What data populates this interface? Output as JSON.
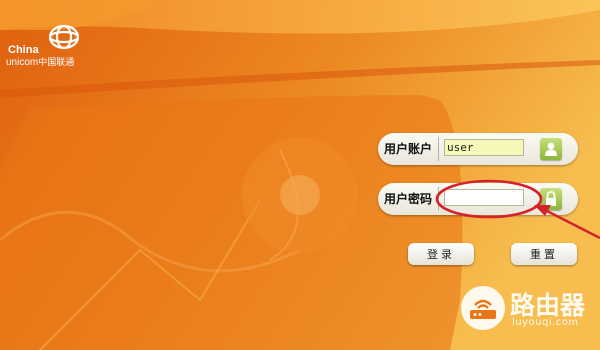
{
  "brand": {
    "line1": "China",
    "line2": "unicom",
    "line2_cn": "中国联通",
    "icon": "unicom-knot-logo"
  },
  "login": {
    "username_label": "用户账户",
    "username_value": "user",
    "username_icon": "user-icon",
    "password_label": "用户密码",
    "password_value": "",
    "password_icon": "lock-icon",
    "login_button": "登录",
    "reset_button": "重置"
  },
  "watermark": {
    "title": "路由器",
    "url": "luyouqi.com",
    "icon": "router-icon"
  },
  "colors": {
    "background": "#e8741a",
    "highlight": "#f7b84a",
    "annotation": "#d4222a",
    "icon_green": "#9cc444"
  }
}
